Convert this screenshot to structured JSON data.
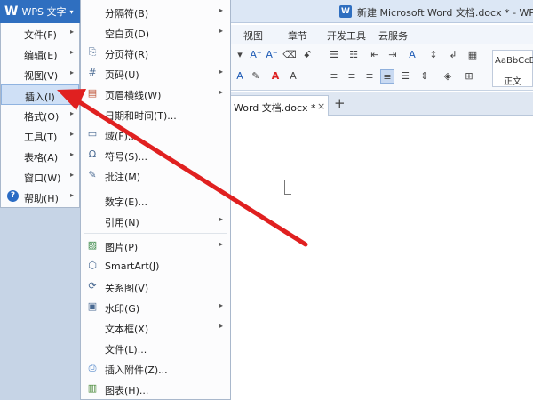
{
  "app": {
    "logo": "W",
    "name": "WPS 文字",
    "caret": "▾",
    "doc_icon": "W",
    "window_title": "新建 Microsoft Word 文档.docx * - WPS 文"
  },
  "ribbon": {
    "tabs": [
      "视图",
      "章节",
      "开发工具",
      "云服务"
    ],
    "style_sample": "AaBbCcDd",
    "style_name": "正文"
  },
  "doc_tab": {
    "title": "Word 文档.docx *",
    "close": "×",
    "new": "+"
  },
  "main_menu": {
    "items": [
      {
        "label": "文件(F)"
      },
      {
        "label": "编辑(E)"
      },
      {
        "label": "视图(V)"
      },
      {
        "label": "插入(I)"
      },
      {
        "label": "格式(O)"
      },
      {
        "label": "工具(T)"
      },
      {
        "label": "表格(A)"
      },
      {
        "label": "窗口(W)"
      },
      {
        "label": "帮助(H)"
      }
    ],
    "arrow_glyph": "▸"
  },
  "submenu": {
    "items": [
      {
        "label": "分隔符(B)"
      },
      {
        "label": "空白页(D)"
      },
      {
        "label": "分页符(R)"
      },
      {
        "label": "页码(U)"
      },
      {
        "label": "页眉横线(W)"
      },
      {
        "label": "日期和时间(T)..."
      },
      {
        "label": "域(F)..."
      },
      {
        "label": "符号(S)..."
      },
      {
        "label": "批注(M)"
      },
      {
        "label": "数字(E)..."
      },
      {
        "label": "引用(N)"
      },
      {
        "label": "图片(P)"
      },
      {
        "label": "SmartArt(J)"
      },
      {
        "label": "关系图(V)"
      },
      {
        "label": "水印(G)"
      },
      {
        "label": "文本框(X)"
      },
      {
        "label": "文件(L)..."
      },
      {
        "label": "插入附件(Z)..."
      },
      {
        "label": "图表(H)..."
      }
    ]
  },
  "colors": {
    "annotation_arrow": "#e02020",
    "title_accent": "#2f6fc0"
  }
}
